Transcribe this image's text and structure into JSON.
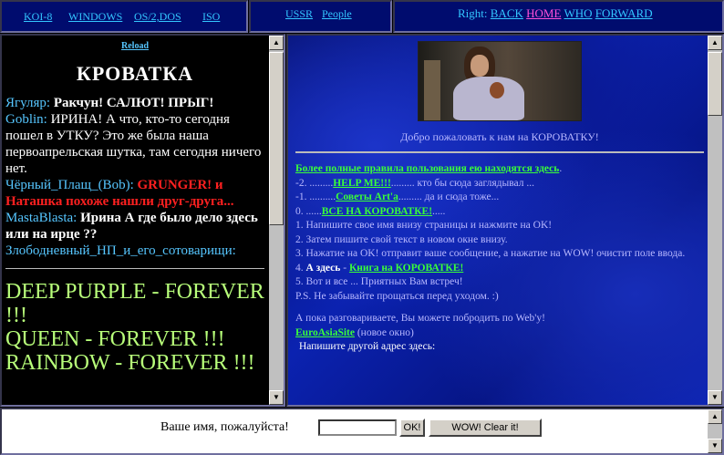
{
  "top": {
    "encodings": [
      "KOI-8",
      "WINDOWS",
      "OS/2,DOS",
      "ISO"
    ],
    "links": [
      "USSR",
      "People"
    ],
    "nav_label": "Right:",
    "nav": [
      "BACK",
      "HOME",
      "WHO",
      "FORWARD"
    ]
  },
  "left": {
    "reload": "Reload",
    "title": "КРОВАТКА",
    "messages": [
      {
        "user": "Ягуляр",
        "text": "Ракчун! САЛЮТ! ПРЫГ!"
      },
      {
        "user": "Goblin",
        "text": "ИРИНА! А что, кто-то сегодня пошел в УТКУ? Это же была наша первоапрельская шутка, там сегодня ничего нет."
      },
      {
        "user": "Чёрный_Плащ_(Bob)",
        "text": "GRUNGER! и Наташка похоже нашли друг-друга..."
      },
      {
        "user": "MastaBlasta",
        "text": "Ирина А где было дело здесь или на ирце ??"
      },
      {
        "user": "Злободневный_НП_и_его_сотоварищи",
        "text": ""
      }
    ],
    "big_lines": [
      "DEEP PURPLE - FOREVER !!!",
      "QUEEN - FOREVER !!!",
      "RAINBOW - FOREVER !!!"
    ]
  },
  "right": {
    "welcome": "Добро пожаловать к нам на КОРОВАТКУ!",
    "rules_link": "Более полные правила пользования ею находятся здесь",
    "line_minus2_prefix": "-2. .........",
    "help_link": "HELP ME!!!",
    "line_minus2_suffix": "......... кто бы сюда заглядывал ...",
    "line_minus1_prefix": "-1. ..........",
    "advice_link": "Советы Art'a",
    "line_minus1_suffix": "......... да и сюда тоже...",
    "line_0_prefix": "0. ......",
    "all_link": "ВСЕ НА КОРОВАТКЕ!",
    "line_0_suffix": ".....",
    "step1": "1. Напишите свое имя внизу страницы и нажмите на OK!",
    "step2": "2. Затем пишите свой текст в новом окне внизу.",
    "step3": "3. Нажатие на OK! отправит ваше сообщение, а нажатие на WOW! очистит поле ввода.",
    "step4_prefix": "4.",
    "step4_bold": "А здесь",
    "step4_dash": "-",
    "book_link": "Книга на КОРОВАТКЕ!",
    "step5": "5. Вот и все ... Приятных Вам встреч!",
    "ps": "P.S. Не забывайте прощаться перед уходом. :)",
    "goodbye": "А пока разговариваете, Вы можете побродить по Web'у!",
    "site_link": "EuroAsiaSite",
    "site_suffix": "(новое окно)",
    "other_address": "Напишите другой адрес здесь:"
  },
  "bottom": {
    "name_label": "Ваше имя, пожалуйста!",
    "name_value": "",
    "ok_button": "OK!",
    "clear_button": "WOW! Clear it!"
  },
  "colors": {
    "frame_bg": "#000c6e",
    "link_cyan": "#33c6ff",
    "link_home": "#ff4fd8",
    "accent_green": "#39ff39",
    "big_text_green": "#b8ff7a",
    "alert_red": "#ff2020"
  }
}
